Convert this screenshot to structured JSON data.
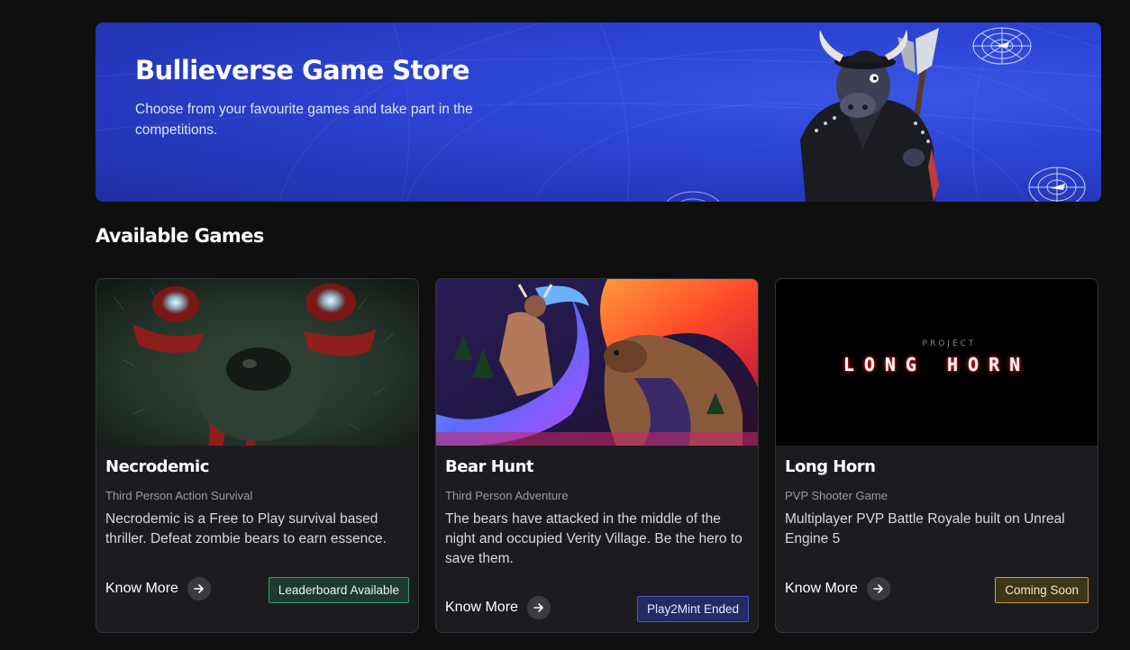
{
  "banner": {
    "title": "Bullieverse Game Store",
    "subtitle": "Choose from your favourite games and take part in the competitions."
  },
  "section": {
    "title": "Available Games"
  },
  "games": [
    {
      "title": "Necrodemic",
      "genre": "Third Person Action Survival",
      "description": "Necrodemic is a Free to Play survival based thriller. Defeat zombie bears to earn essence.",
      "cta": "Know More",
      "badge": "Leaderboard Available",
      "badge_color": "#34a06a"
    },
    {
      "title": "Bear Hunt",
      "genre": "Third Person Adventure",
      "description": "The bears have attacked in the middle of the night and occupied Verity Village. Be the hero to save them.",
      "cta": "Know More",
      "badge": "Play2Mint Ended",
      "badge_color": "#4a58c6"
    },
    {
      "title": "Long Horn",
      "genre": "PVP Shooter Game",
      "description": "Multiplayer PVP Battle Royale built on Unreal Engine 5",
      "cta": "Know More",
      "badge": "Coming Soon",
      "badge_color": "#c9a530",
      "logo_small": "PROJECT",
      "logo_large": "LONG HORN"
    }
  ],
  "colors": {
    "background": "#0f0f10",
    "banner": "#2c44d6",
    "card": "#1c1c20"
  },
  "icons": [
    "arrow-right-icon",
    "radar-icon"
  ]
}
